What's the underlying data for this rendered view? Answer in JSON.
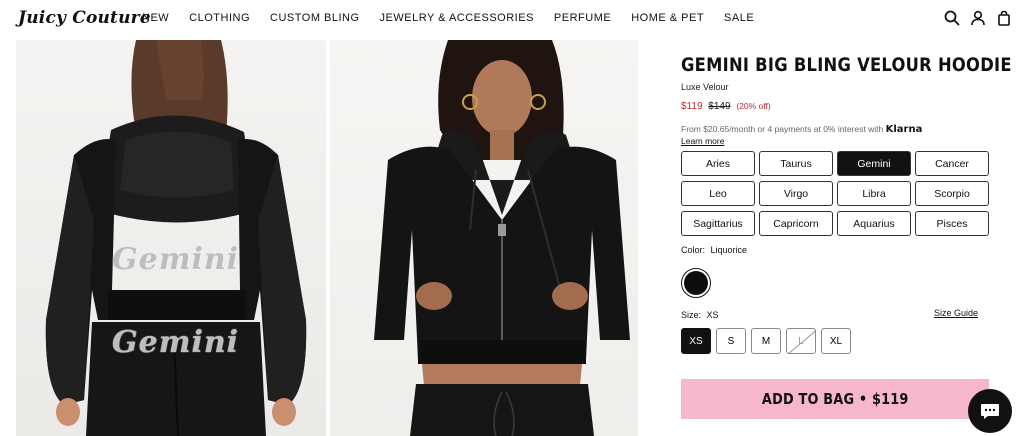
{
  "brand": {
    "logo_text": "Juicy Couture"
  },
  "nav": {
    "items": [
      "NEW",
      "CLOTHING",
      "CUSTOM BLING",
      "JEWELRY & ACCESSORIES",
      "PERFUME",
      "HOME & PET",
      "SALE"
    ]
  },
  "header_icons": [
    "search-icon",
    "account-icon",
    "bag-icon"
  ],
  "product": {
    "title": "GEMINI BIG BLING VELOUR HOODIE",
    "subtitle": "Luxe Velour",
    "price_now": "$119",
    "price_old": "$149",
    "price_off": "(20% off)",
    "klarna_text": "From $20.65/month or 4 payments at 0% interest with",
    "klarna_brand": "Klarna",
    "learn_more": "Learn more",
    "back_text": "Gemini",
    "signs": [
      "Aries",
      "Taurus",
      "Gemini",
      "Cancer",
      "Leo",
      "Virgo",
      "Libra",
      "Scorpio",
      "Sagittarius",
      "Capricorn",
      "Aquarius",
      "Pisces"
    ],
    "selected_sign": "Gemini",
    "color_label": "Color:",
    "color_value": "Liquorice",
    "color_hex": "#0d0d0d",
    "size_label": "Size:",
    "size_value": "XS",
    "size_guide": "Size Guide",
    "sizes": [
      "XS",
      "S",
      "M",
      "L",
      "XL"
    ],
    "unavailable_sizes": [
      "L"
    ],
    "add_to_bag": "ADD TO BAG • $119"
  },
  "colors": {
    "accent_pink": "#f6b7cc",
    "sale_red": "#c62828"
  }
}
